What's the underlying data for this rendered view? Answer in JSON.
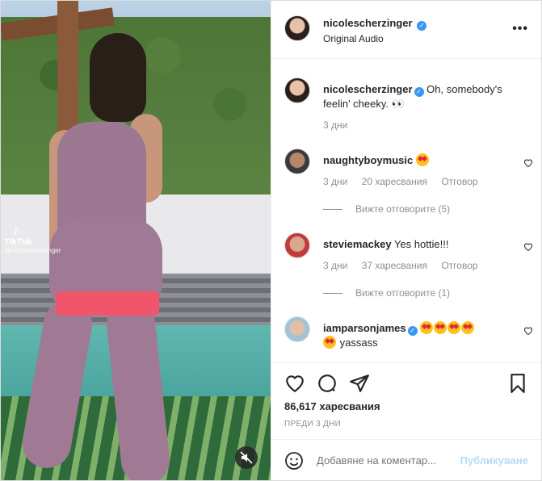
{
  "header": {
    "username": "nicolescherzinger",
    "subtitle": "Original Audio",
    "more": "•••"
  },
  "media": {
    "watermark_brand": "TikTok",
    "watermark_handle": "@nicolescherzinger"
  },
  "caption": {
    "username": "nicolescherzinger",
    "text": "Oh, somebody's feelin' cheeky. 👀",
    "time": "3 дни"
  },
  "comments": [
    {
      "username": "naughtyboymusic",
      "text": "",
      "time": "3 дни",
      "likes": "20 харесвания",
      "reply": "Отговор",
      "view_replies": "Вижте отговорите (5)"
    },
    {
      "username": "steviemackey",
      "text": "Yes hottie!!!",
      "time": "3 дни",
      "likes": "37 харесвания",
      "reply": "Отговор",
      "view_replies": "Вижте отговорите (1)"
    },
    {
      "username": "iamparsonjames",
      "text": "yassass"
    }
  ],
  "actions": {
    "likes_count": "86,617 харесвания",
    "date": "ПРЕДИ 3 ДНИ",
    "comment_placeholder": "Добавяне на коментар...",
    "post_button": "Публикуване"
  },
  "colors": {
    "accent": "#3897f0",
    "post_disabled": "#b3dbff",
    "muted_text": "#8e8e8e"
  }
}
